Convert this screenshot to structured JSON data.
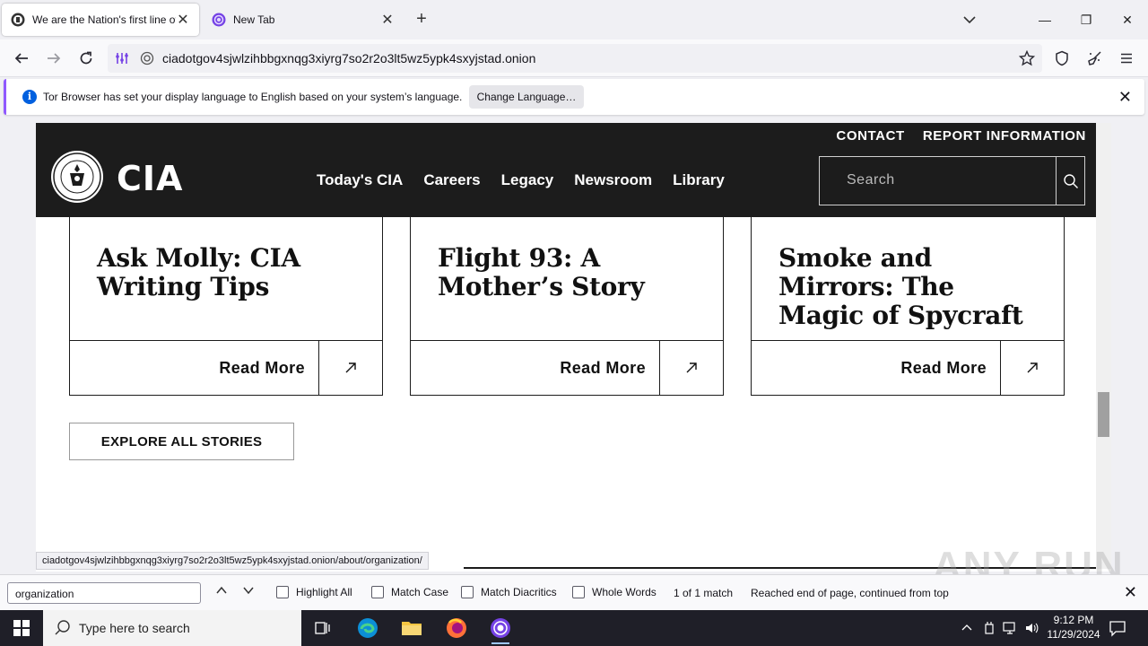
{
  "tabs": [
    {
      "title": "We are the Nation's first line of",
      "active": true
    },
    {
      "title": "New Tab",
      "active": false
    }
  ],
  "toolbar": {
    "url": "ciadotgov4sjwlzihbbgxnqg3xiyrg7so2r2o3lt5wz5ypk4sxyjstad.onion"
  },
  "notification": {
    "message": "Tor Browser has set your display language to English based on your system’s language.",
    "button_label": "Change Language…",
    "info_glyph": "i"
  },
  "site": {
    "logo_text": "CIA",
    "top_links": [
      "CONTACT",
      "REPORT INFORMATION"
    ],
    "nav": [
      "Today's CIA",
      "Careers",
      "Legacy",
      "Newsroom",
      "Library"
    ],
    "search_placeholder": "Search",
    "cards": [
      {
        "title": "Ask Molly: CIA Writing Tips",
        "cta": "Read More"
      },
      {
        "title": "Flight 93: A Mother’s Story",
        "cta": "Read More"
      },
      {
        "title": "Smoke and Mirrors: The Magic of Spycraft",
        "cta": "Read More"
      }
    ],
    "explore_label": "EXPLORE ALL STORIES"
  },
  "status_url": "ciadotgov4sjwlzihbbgxnqg3xiyrg7so2r2o3lt5wz5ypk4sxyjstad.onion/about/organization/",
  "findbar": {
    "query": "organization",
    "options": [
      "Highlight All",
      "Match Case",
      "Match Diacritics",
      "Whole Words"
    ],
    "matches": "1 of 1 match",
    "status": "Reached end of page, continued from top"
  },
  "watermark": "ANY RUN",
  "taskbar": {
    "search_placeholder": "Type here to search",
    "time": "9:12 PM",
    "date": "11/29/2024"
  },
  "colors": {
    "accent": "#9059ff",
    "cia_header": "#1c1c1c",
    "info_blue": "#0060df"
  }
}
